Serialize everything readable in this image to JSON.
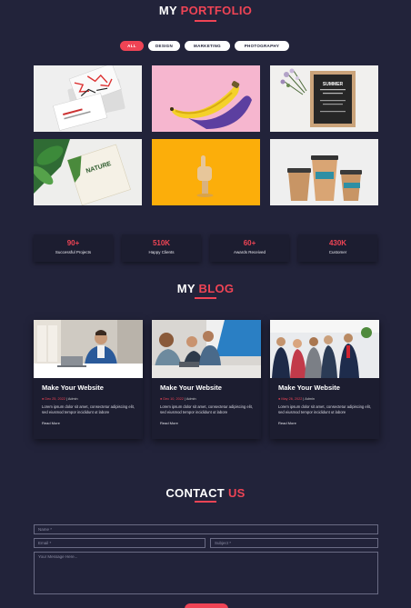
{
  "portfolio": {
    "title_main": "MY",
    "title_accent": "PORTFOLIO",
    "filters": [
      {
        "label": "All",
        "active": true
      },
      {
        "label": "Design",
        "active": false
      },
      {
        "label": "Marketing",
        "active": false
      },
      {
        "label": "Photography",
        "active": false
      }
    ],
    "items": [
      {
        "name": "business-cards",
        "background": "#efefef"
      },
      {
        "name": "banana",
        "background": "#f6b6cf"
      },
      {
        "name": "summer-board",
        "background": "#f1f0ee",
        "text": "SUMMER"
      },
      {
        "name": "nature-book",
        "background": "#eeeeec",
        "text": "NATURE"
      },
      {
        "name": "wooden-hand",
        "background": "#fcae0a"
      },
      {
        "name": "coffee-cups",
        "background": "#efefef"
      }
    ]
  },
  "stats": [
    {
      "value": "90+",
      "label": "Successful Projects"
    },
    {
      "value": "510K",
      "label": "Happy Clients"
    },
    {
      "value": "60+",
      "label": "Awards Received"
    },
    {
      "value": "430K",
      "label": "Customer"
    }
  ],
  "blog": {
    "title_main": "MY",
    "title_accent": "BLOG",
    "posts": [
      {
        "title": "Make Your Website",
        "date": "● Dec 25, 2022",
        "author": "| Admin",
        "excerpt": "Lorem ipsum dolor sit amet, consectetur adipiscing elit, sed eiusmod tempor incididunt ut labore",
        "more": "Read More"
      },
      {
        "title": "Make Your Website",
        "date": "● Dec 10, 2022",
        "author": "| Admin",
        "excerpt": "Lorem ipsum dolor sit amet, consectetur adipiscing elit, sed eiusmod tempor incididunt ut labore",
        "more": "Read More"
      },
      {
        "title": "Make Your Website",
        "date": "● May 26, 2022",
        "author": "| Admin",
        "excerpt": "Lorem ipsum dolor sit amet, consectetur adipiscing elit, sed eiusmod tempor incididunt ut labore",
        "more": "Read More"
      }
    ]
  },
  "contact": {
    "title_main": "CONTACT",
    "title_accent": "US",
    "name_placeholder": "Name *",
    "email_placeholder": "Email *",
    "subject_placeholder": "Subject *",
    "message_placeholder": "Your Message Here..."
  },
  "colors": {
    "background": "#22233a",
    "accent": "#ef4455",
    "card": "#1c1d30"
  }
}
